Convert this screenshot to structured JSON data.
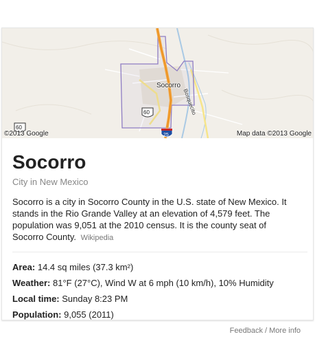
{
  "map": {
    "copyright_left": "©2013 Google",
    "copyright_right": "Map data ©2013 Google",
    "city_label": "Socorro",
    "river_label": "Bosquecito",
    "shields": {
      "us60_top": "60",
      "us60_bottom": "60",
      "i25": "25"
    }
  },
  "entity": {
    "title": "Socorro",
    "subtitle": "City in New Mexico",
    "description": "Socorro is a city in Socorro County in the U.S. state of New Mexico. It stands in the Rio Grande Valley at an elevation of 4,579 feet. The population was 9,051 at the 2010 census. It is the county seat of Socorro County.",
    "source": "Wikipedia"
  },
  "facts": [
    {
      "label": "Area:",
      "value": " 14.4 sq miles (37.3 km²)"
    },
    {
      "label": "Weather:",
      "value": " 81°F (27°C), Wind W at 6 mph (10 km/h), 10% Humidity"
    },
    {
      "label": "Local time:",
      "value": " Sunday 8:23 PM"
    },
    {
      "label": "Population:",
      "value": " 9,055 (2011)"
    }
  ],
  "footer": {
    "feedback": "Feedback",
    "separator": " / ",
    "more_info": "More info"
  },
  "colors": {
    "boundary": "#8e7cc3",
    "highway": "#f5a623",
    "river": "#9ecae1",
    "map_bg": "#f2efe9"
  }
}
